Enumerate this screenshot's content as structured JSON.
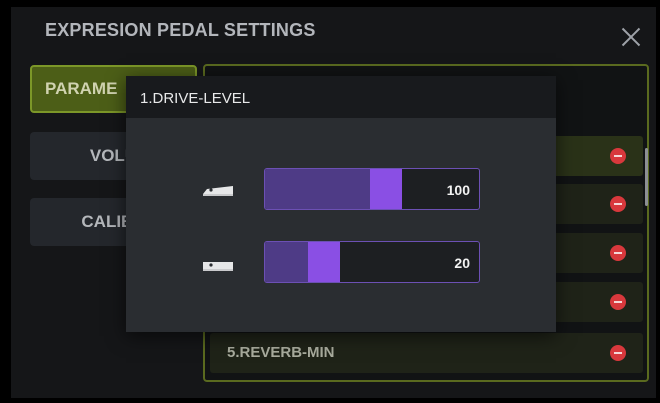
{
  "window": {
    "title": "EXPRESION PEDAL SETTINGS"
  },
  "sidebar": {
    "items": [
      {
        "label": "PARAMETERS",
        "visible_label": "PARAME",
        "active": true
      },
      {
        "label": "VOLUME",
        "visible_label": "VOLU",
        "active": false
      },
      {
        "label": "CALIBRATE",
        "visible_label": "CALIBR",
        "active": false
      }
    ]
  },
  "parameters": {
    "rows": [
      {
        "label": ""
      },
      {
        "label": ""
      },
      {
        "label": ""
      },
      {
        "label": ""
      },
      {
        "label": "5.REVERB-MIN"
      }
    ]
  },
  "dialog": {
    "title": "1.DRIVE-LEVEL",
    "max": {
      "icon": "pedal-toe-down-icon",
      "value": "100",
      "level_percent": 100
    },
    "min": {
      "icon": "pedal-heel-down-icon",
      "value": "20",
      "level_percent": 20
    }
  },
  "colors": {
    "accent_green": "#7c9728",
    "accent_purple": "#8a4fe4",
    "remove_red": "#d8383c"
  }
}
